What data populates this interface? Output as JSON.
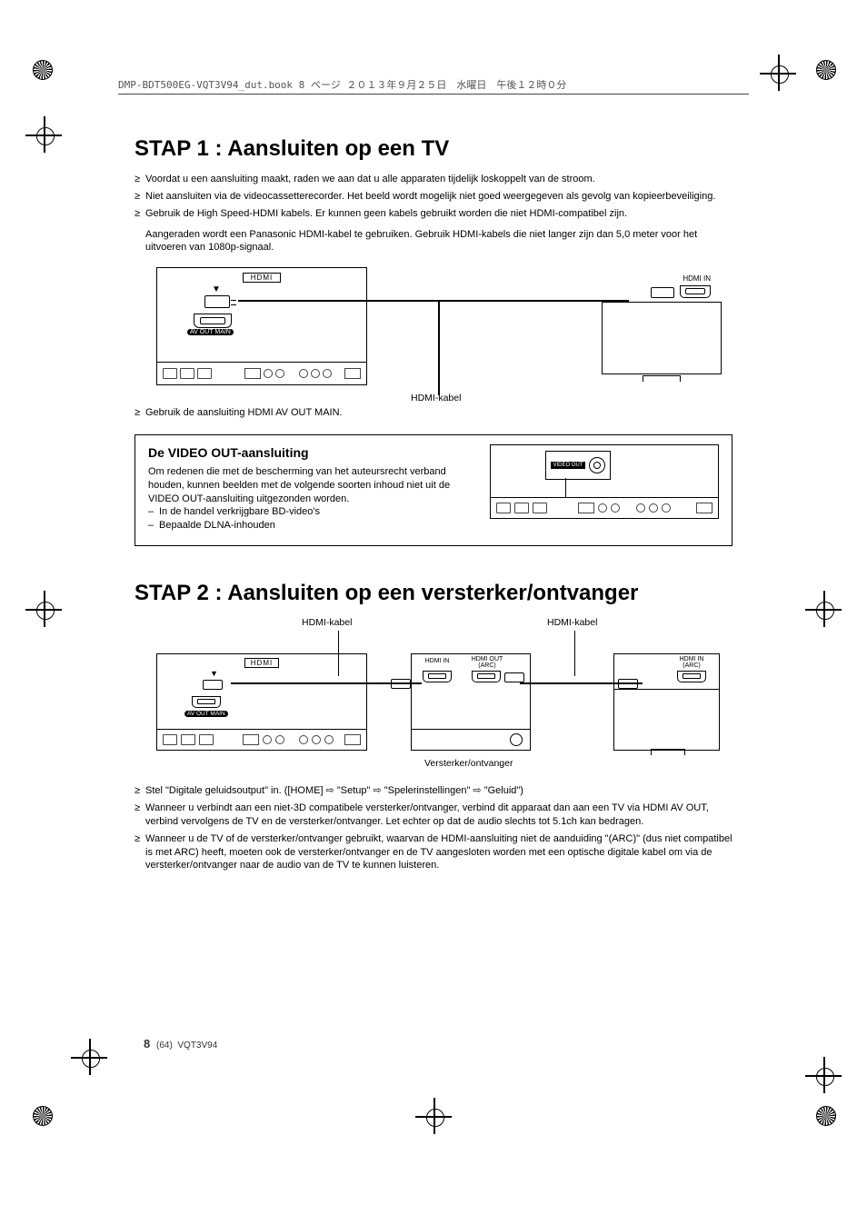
{
  "header_text": "DMP-BDT500EG-VQT3V94_dut.book  8 ページ  ２０１３年９月２５日　水曜日　午後１２時０分",
  "stap1": {
    "title": "STAP 1 :  Aansluiten op een TV",
    "bullets": [
      "Voordat u een aansluiting maakt, raden we aan dat u alle apparaten tijdelijk loskoppelt van de stroom.",
      "Niet aansluiten via de videocassetterecorder. Het beeld wordt mogelijk niet goed weergegeven als gevolg van kopieerbeveiliging.",
      "Gebruik de High Speed-HDMI kabels. Er kunnen geen kabels gebruikt worden die niet HDMI-compatibel zijn."
    ],
    "bullet3_sub": "Aangeraden wordt een Panasonic HDMI-kabel te gebruiken. Gebruik HDMI-kabels die niet langer zijn dan 5,0 meter voor het uitvoeren van 1080p-signaal.",
    "diag": {
      "hdmi_logo": "HDMI",
      "av_out_label": "AV OUT  MAIN",
      "hdmi_in_label": "HDMI IN",
      "cable_label": "HDMI-kabel"
    },
    "after_bullet": "Gebruik de aansluiting HDMI AV OUT MAIN."
  },
  "video_out": {
    "title": "De VIDEO OUT-aansluiting",
    "intro": "Om redenen die met de bescherming van het auteursrecht verband houden, kunnen beelden met de volgende soorten inhoud niet uit de VIDEO OUT-aansluiting uitgezonden worden.",
    "items": [
      "In de handel verkrijgbare BD-video's",
      "Bepaalde DLNA-inhouden"
    ],
    "port_label": "VIDEO OUT"
  },
  "stap2": {
    "title": "STAP 2 :  Aansluiten op een versterker/ontvanger",
    "cable_left": "HDMI-kabel",
    "cable_right": "HDMI-kabel",
    "amp_caption": "Versterker/ontvanger",
    "hdmi_logo": "HDMI",
    "av_out_label": "AV OUT  MAIN",
    "amp_labels": {
      "in": "HDMI IN",
      "out": "HDMI OUT\n(ARC)"
    },
    "tv_label": "HDMI IN\n(ARC)",
    "bullets": [
      "Stel \"Digitale geluidsoutput\" in. ([HOME] ⇨ \"Setup\" ⇨ \"Spelerinstellingen\" ⇨ \"Geluid\")",
      "Wanneer u verbindt aan een niet-3D compatibele versterker/ontvanger, verbind dit apparaat dan aan een TV via HDMI AV OUT, verbind vervolgens de TV en de versterker/ontvanger. Let echter op dat de audio slechts tot 5.1ch kan bedragen.",
      "Wanneer u de TV of de versterker/ontvanger gebruikt, waarvan de HDMI-aansluiting niet de aanduiding \"(ARC)\" (dus niet compatibel is met ARC) heeft, moeten ook de versterker/ontvanger en de TV aangesloten worden met een optische digitale kabel om via de versterker/ontvanger naar de audio van de TV te kunnen luisteren."
    ]
  },
  "footer": {
    "page_bold": "8",
    "page_paren": "(64)",
    "doc_code": "VQT3V94"
  }
}
